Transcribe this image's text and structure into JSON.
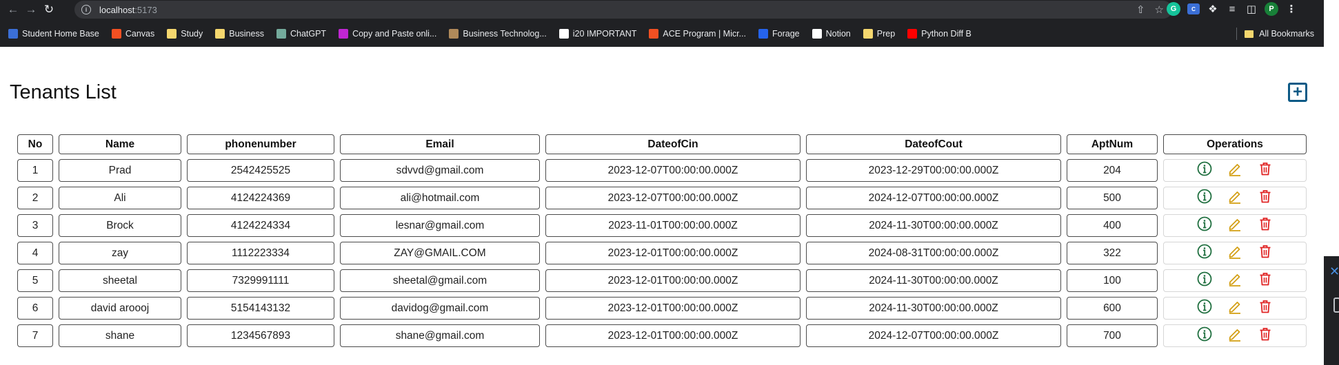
{
  "browser": {
    "url_host": "localhost",
    "url_port": ":5173",
    "profile_initial": "P",
    "bookmarks": [
      {
        "label": "Student Home Base",
        "color": "#3b6fd6"
      },
      {
        "label": "Canvas",
        "color": "#f25022"
      },
      {
        "label": "Study",
        "color": "#f5d76e"
      },
      {
        "label": "Business",
        "color": "#f5d76e"
      },
      {
        "label": "ChatGPT",
        "color": "#74aa9c"
      },
      {
        "label": "Copy and Paste onli...",
        "color": "#c026d3"
      },
      {
        "label": "Business Technolog...",
        "color": "#b08a5a"
      },
      {
        "label": "i20 IMPORTANT",
        "color": "#ffffff"
      },
      {
        "label": "ACE Program | Micr...",
        "color": "#f25022"
      },
      {
        "label": "Forage",
        "color": "#2563eb"
      },
      {
        "label": "Notion",
        "color": "#ffffff"
      },
      {
        "label": "Prep",
        "color": "#f5d76e"
      },
      {
        "label": "Python Diff B",
        "color": "#ff0000"
      }
    ],
    "all_bookmarks_label": "All Bookmarks"
  },
  "page": {
    "title": "Tenants List"
  },
  "table": {
    "headers": [
      "No",
      "Name",
      "phonenumber",
      "Email",
      "DateofCin",
      "DateofCout",
      "AptNum",
      "Operations"
    ],
    "rows": [
      [
        "1",
        "Prad",
        "2542425525",
        "sdvvd@gmail.com",
        "2023-12-07T00:00:00.000Z",
        "2023-12-29T00:00:00.000Z",
        "204"
      ],
      [
        "2",
        "Ali",
        "4124224369",
        "ali@hotmail.com",
        "2023-12-07T00:00:00.000Z",
        "2024-12-07T00:00:00.000Z",
        "500"
      ],
      [
        "3",
        "Brock",
        "4124224334",
        "lesnar@gmail.com",
        "2023-11-01T00:00:00.000Z",
        "2024-11-30T00:00:00.000Z",
        "400"
      ],
      [
        "4",
        "zay",
        "1112223334",
        "ZAY@GMAIL.COM",
        "2023-12-01T00:00:00.000Z",
        "2024-08-31T00:00:00.000Z",
        "322"
      ],
      [
        "5",
        "sheetal",
        "7329991111",
        "sheetal@gmail.com",
        "2023-12-01T00:00:00.000Z",
        "2024-11-30T00:00:00.000Z",
        "100"
      ],
      [
        "6",
        "david aroooj",
        "5154143132",
        "davidog@gmail.com",
        "2023-12-01T00:00:00.000Z",
        "2024-11-30T00:00:00.000Z",
        "600"
      ],
      [
        "7",
        "shane",
        "1234567893",
        "shane@gmail.com",
        "2023-12-01T00:00:00.000Z",
        "2024-12-07T00:00:00.000Z",
        "700"
      ]
    ]
  },
  "icons": {
    "info": "info-circle-icon",
    "edit": "pencil-icon",
    "delete": "trash-icon",
    "add": "plus-square-icon"
  },
  "colors": {
    "info": "#1f6f3f",
    "edit": "#d4a017",
    "delete": "#e02424",
    "add": "#0d5a86"
  }
}
